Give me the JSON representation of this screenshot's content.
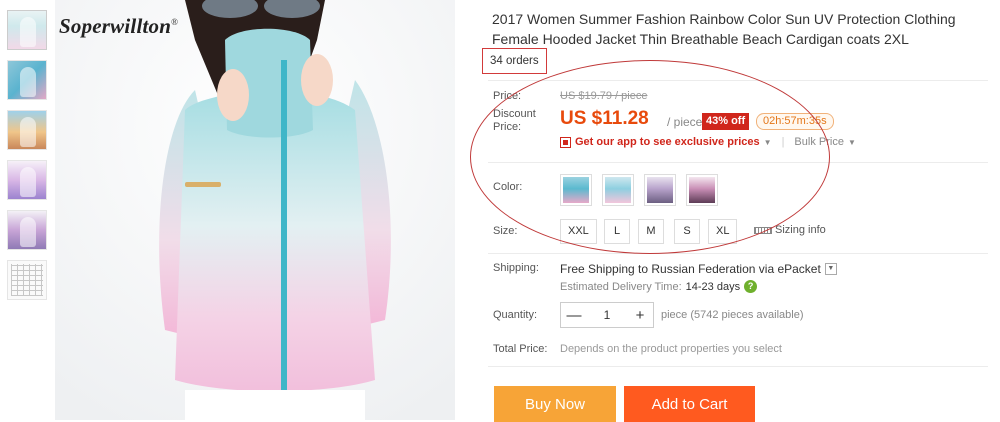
{
  "brand": {
    "name": "Soperwillton",
    "mark": "®"
  },
  "thumbnails": [
    {
      "icon": "product-thumb-front"
    },
    {
      "icon": "product-thumb-sunglasses"
    },
    {
      "icon": "product-thumb-beach"
    },
    {
      "icon": "product-thumb-purple"
    },
    {
      "icon": "product-thumb-back"
    },
    {
      "icon": "size-chart-thumb"
    }
  ],
  "product": {
    "title": "2017 Women Summer Fashion Rainbow Color Sun UV Protection Clothing Female Hooded Jacket Thin Breathable Beach Cardigan coats 2XL",
    "orders": "34 orders"
  },
  "price": {
    "label": "Price:",
    "original": "US $19.79 / piece",
    "discount_label": "Discount Price:",
    "discount": "US $11.28",
    "unit": "/ piece",
    "off_badge": "43% off",
    "timer": "02h:57m:35s",
    "app_promo": "Get our app to see exclusive prices",
    "bulk": "Bulk Price",
    "accent_color": "#e84a0c"
  },
  "color": {
    "label": "Color:",
    "swatches": [
      "Blue",
      "Light Blue",
      "Purple",
      "Pink"
    ]
  },
  "size": {
    "label": "Size:",
    "options": [
      "XXL",
      "L",
      "M",
      "S",
      "XL"
    ],
    "sizing_info": "Sizing info"
  },
  "shipping": {
    "label": "Shipping:",
    "text": "Free Shipping to Russian Federation via ePacket",
    "delivery_label": "Estimated Delivery Time:",
    "delivery_time": "14-23 days"
  },
  "quantity": {
    "label": "Quantity:",
    "value": "1",
    "minus": "—",
    "plus": "+",
    "available": "piece (5742 pieces available)"
  },
  "total": {
    "label": "Total Price:",
    "text": "Depends on the product properties you select"
  },
  "actions": {
    "buy_now": "Buy Now",
    "add_to_cart": "Add to Cart"
  }
}
